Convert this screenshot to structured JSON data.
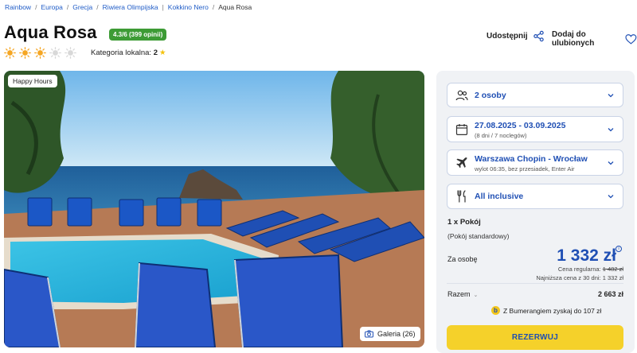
{
  "breadcrumb": [
    "Rainbow",
    "Europa",
    "Grecja",
    "Riwiera Olimpijska",
    "Kokkino Nero",
    "Aqua Rosa"
  ],
  "hotel": {
    "name": "Aqua Rosa",
    "rating": "4.3/6 (399 opinii)",
    "stars_total": 5,
    "stars_filled": 3,
    "local_category_label": "Kategoria lokalna:",
    "local_category_value": "2"
  },
  "actions": {
    "share": "Udostępnij",
    "favorite": "Dodaj do ulubionych"
  },
  "photo": {
    "badge": "Happy Hours",
    "gallery": "Galeria (26)"
  },
  "booking": {
    "persons": "2 osoby",
    "dates": "27.08.2025 - 03.09.2025",
    "dates_sub": "(8 dni / 7 noclegów)",
    "flight": "Warszawa Chopin - Wrocław",
    "flight_sub": "wylot 06:35, bez przesiadek, Enter Air",
    "board": "All inclusive",
    "room": "1 x Pokój",
    "room_type": "(Pokój standardowy)",
    "per_person_label": "Za osobę",
    "price": "1 332 zł",
    "regular_label": "Cena regularna:",
    "regular_price": "1 482 zł",
    "lowest_label": "Najniższa cena z 30 dni: 1 332 zł",
    "total_label": "Razem",
    "total_value": "2 663 zł",
    "bumerang": "Z Bumerangiem zyskaj do 107 zł",
    "reserve": "REZERWUJ"
  },
  "colors": {
    "accent": "#1f4fb4",
    "rating_badge": "#3d9b35",
    "reserve_button": "#f5d12a",
    "sun_filled": "#f5a623",
    "sun_empty": "#d8d8d8"
  }
}
